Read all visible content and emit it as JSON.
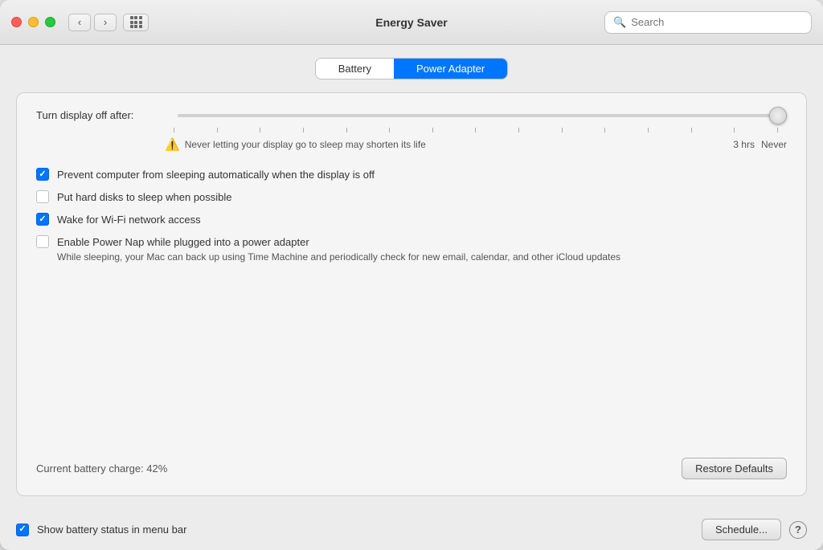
{
  "titlebar": {
    "title": "Energy Saver",
    "search_placeholder": "Search"
  },
  "tabs": [
    {
      "id": "battery",
      "label": "Battery",
      "active": false
    },
    {
      "id": "power_adapter",
      "label": "Power Adapter",
      "active": true
    }
  ],
  "slider": {
    "label": "Turn display off after:",
    "value": 100,
    "tick_count": 15,
    "time_label_1": "3 hrs",
    "time_label_2": "Never"
  },
  "warning": {
    "text": "Never letting your display go to sleep may shorten its life"
  },
  "checkboxes": [
    {
      "id": "prevent_sleep",
      "label": "Prevent computer from sleeping automatically when the display is off",
      "checked": true,
      "sublabel": ""
    },
    {
      "id": "hard_disks",
      "label": "Put hard disks to sleep when possible",
      "checked": false,
      "sublabel": ""
    },
    {
      "id": "wifi",
      "label": "Wake for Wi-Fi network access",
      "checked": true,
      "sublabel": ""
    },
    {
      "id": "power_nap",
      "label": "Enable Power Nap while plugged into a power adapter",
      "checked": false,
      "sublabel": "While sleeping, your Mac can back up using Time Machine and periodically check for new email, calendar, and other iCloud updates"
    }
  ],
  "battery_status": "Current battery charge: 42%",
  "buttons": {
    "restore_defaults": "Restore Defaults",
    "schedule": "Schedule...",
    "help": "?"
  },
  "footer": {
    "show_battery_label": "Show battery status in menu bar",
    "show_battery_checked": true
  }
}
